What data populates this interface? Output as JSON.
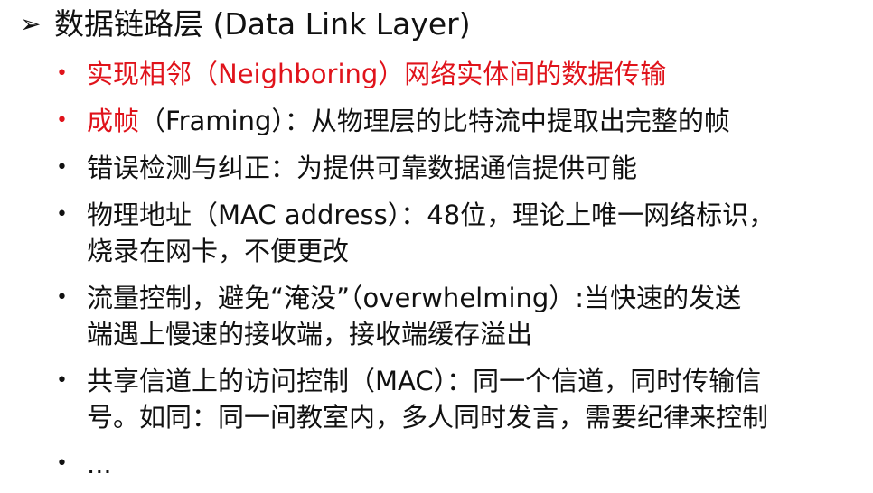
{
  "heading": {
    "arrow": "➢",
    "text": "数据链路层 (Data Link Layer)"
  },
  "colors": {
    "text": "#111111",
    "highlight": "#e0131b"
  },
  "bullets": [
    {
      "marker": "•",
      "marker_color": "#e0131b",
      "highlight": "实现相邻（Neighboring）网络实体间的数据传输",
      "text": "",
      "line2": ""
    },
    {
      "marker": "•",
      "marker_color": "#e0131b",
      "highlight": "成帧",
      "text": "（Framing）：从物理层的比特流中提取出完整的帧",
      "line2": ""
    },
    {
      "marker": "•",
      "marker_color": "#111111",
      "highlight": "",
      "text": "错误检测与纠正：为提供可靠数据通信提供可能",
      "line2": ""
    },
    {
      "marker": "•",
      "marker_color": "#111111",
      "highlight": "",
      "text": "物理地址（MAC address）：48位，理论上唯一网络标识，",
      "line2": "烧录在网卡，不便更改"
    },
    {
      "marker": "•",
      "marker_color": "#111111",
      "highlight": "",
      "text": "流量控制，避免“淹没”（overwhelming）:当快速的发送",
      "line2": "端遇上慢速的接收端，接收端缓存溢出"
    },
    {
      "marker": "•",
      "marker_color": "#111111",
      "highlight": "",
      "text": "共享信道上的访问控制（MAC）：同一个信道，同时传输信",
      "line2": "号。如同：同一间教室内，多人同时发言，需要纪律来控制"
    },
    {
      "marker": "•",
      "marker_color": "#111111",
      "highlight": "",
      "text": "...",
      "line2": ""
    }
  ]
}
